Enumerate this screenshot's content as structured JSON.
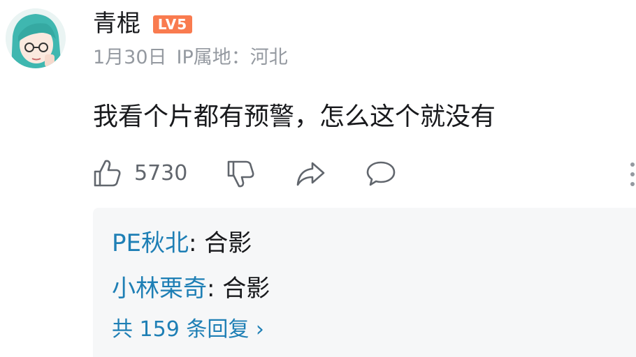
{
  "comment": {
    "username": "青棍",
    "level_badge": "LV5",
    "date": "1月30日",
    "ip_location": "IP属地：河北",
    "text": "我看个片都有预警，怎么这个就没有",
    "like_count": "5730",
    "icons": {
      "like": "thumbs-up-icon",
      "dislike": "thumbs-down-icon",
      "share": "share-icon",
      "reply": "comment-icon",
      "more": "more-vertical-icon"
    }
  },
  "replies": {
    "items": [
      {
        "user": "PE秋北",
        "separator": ": ",
        "text": "合影"
      },
      {
        "user": "小林栗奇",
        "separator": ": ",
        "text": "合影"
      }
    ],
    "more_label": "共 159 条回复 ›"
  },
  "colors": {
    "level_badge": "#f97b4f",
    "link_blue": "#1e7fb5",
    "meta_gray": "#9499a0",
    "reply_bg": "#f6f7f8"
  }
}
